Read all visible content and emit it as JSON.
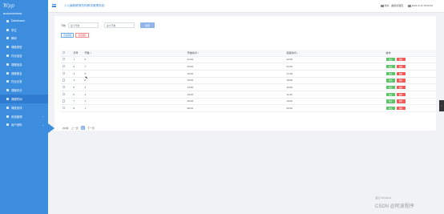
{
  "sidebar": {
    "logo": "Wpp",
    "nav_title": "MAIN NAVIGATION",
    "items": [
      {
        "label": "Dashboard",
        "icon": "dashboard-icon",
        "has_chevron": false,
        "active": false
      },
      {
        "label": "学生",
        "icon": "user-icon",
        "has_chevron": false,
        "active": false
      },
      {
        "label": "教师",
        "icon": "user-icon",
        "has_chevron": false,
        "active": false
      },
      {
        "label": "课程类型",
        "icon": "grid-icon",
        "has_chevron": false,
        "active": false
      },
      {
        "label": "作业信息",
        "icon": "grid-icon",
        "has_chevron": false,
        "active": false
      },
      {
        "label": "课程信息",
        "icon": "grid-icon",
        "has_chevron": false,
        "active": false
      },
      {
        "label": "课程报名",
        "icon": "grid-icon",
        "has_chevron": false,
        "active": false
      },
      {
        "label": "作业记录",
        "icon": "grid-icon",
        "has_chevron": false,
        "active": false
      },
      {
        "label": "课程评分",
        "icon": "grid-icon",
        "has_chevron": false,
        "active": false
      },
      {
        "label": "课程时间",
        "icon": "grid-icon",
        "has_chevron": false,
        "active": true
      },
      {
        "label": "课表安排",
        "icon": "grid-icon",
        "has_chevron": false,
        "active": false
      },
      {
        "label": "系统管理",
        "icon": "gear-icon",
        "has_chevron": true,
        "active": false
      },
      {
        "label": "用户资料",
        "icon": "user-icon",
        "has_chevron": true,
        "active": false
      }
    ]
  },
  "header": {
    "title": "少儿编程教育机构教务管理系统",
    "right": {
      "user": "你好 · 超级管理员",
      "datetime": "2024-3-13 15:00:02"
    }
  },
  "search": {
    "label": "节数",
    "input1_placeholder": "最小节数",
    "input2_placeholder": "最大节数",
    "button_label": "搜索"
  },
  "actions": {
    "add_label": "添加数据",
    "delete_label": "批量删除"
  },
  "table": {
    "columns": [
      "",
      "序号",
      "节数 ↕",
      "开始时间 ↕",
      "结束时间 ↕",
      "操作"
    ],
    "rows": [
      {
        "index": "1",
        "section": "6",
        "start": "21:00",
        "end": "22:00"
      },
      {
        "index": "2",
        "section": "7",
        "start": "20:00",
        "end": "21:00"
      },
      {
        "index": "3",
        "section": "5",
        "start": "10:00",
        "end": "17:00"
      },
      {
        "index": "4",
        "section": "6",
        "start": "15:00",
        "end": "16:00"
      },
      {
        "index": "5",
        "section": "4",
        "start": "14:00",
        "end": "15:00"
      },
      {
        "index": "6",
        "section": "3",
        "start": "10:00",
        "end": "11:00"
      },
      {
        "index": "7",
        "section": "2",
        "start": "09:00",
        "end": "10:00"
      },
      {
        "index": "8",
        "section": "1",
        "start": "08:00",
        "end": "09:00"
      }
    ],
    "edit_label": "修改",
    "delete_label": "删除"
  },
  "pagination": {
    "total": "共8条",
    "prev": "上一页",
    "current": "1",
    "next": "下一页"
  },
  "overlay": {
    "watermark": "激活 Windows",
    "csdn": "CSDN @阿波程序"
  }
}
